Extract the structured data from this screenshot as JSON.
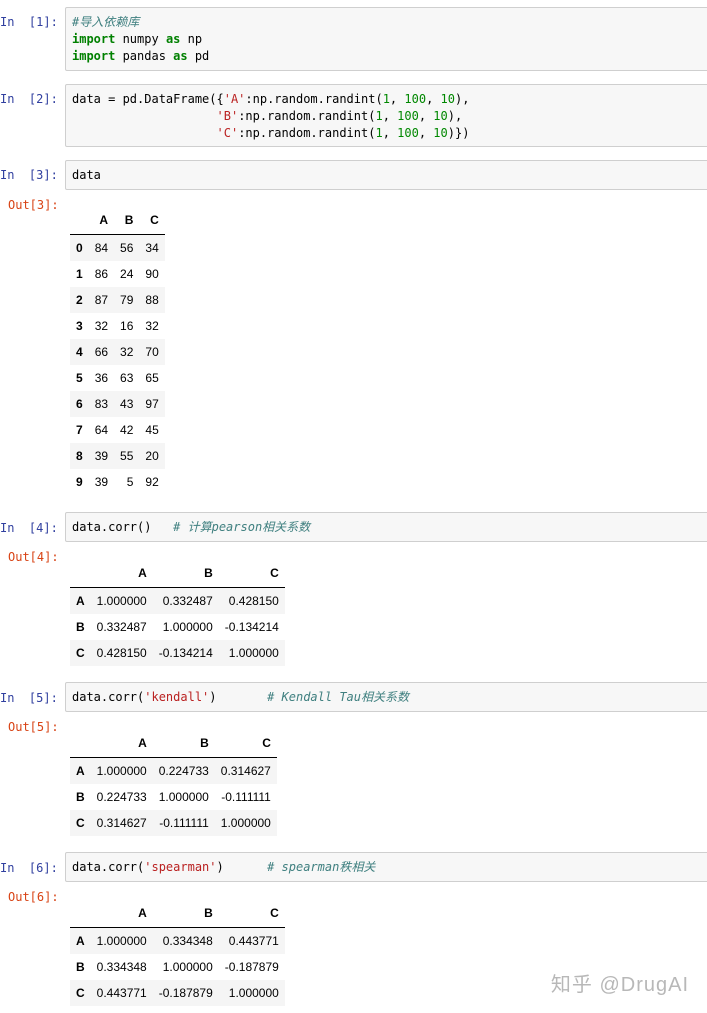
{
  "cells": [
    {
      "prompt": "In  [1]:",
      "lines": [
        [
          {
            "t": "#导入依赖库",
            "c": "cmt"
          }
        ],
        [
          {
            "t": "import",
            "c": "kw"
          },
          {
            "t": " numpy "
          },
          {
            "t": "as",
            "c": "kw"
          },
          {
            "t": " np"
          }
        ],
        [
          {
            "t": "import",
            "c": "kw"
          },
          {
            "t": " pandas "
          },
          {
            "t": "as",
            "c": "kw"
          },
          {
            "t": " pd"
          }
        ]
      ]
    },
    {
      "prompt": "In  [2]:",
      "lines": [
        [
          {
            "t": "data = pd.DataFrame({"
          },
          {
            "t": "'A'",
            "c": "str"
          },
          {
            "t": ":np.random.randint("
          },
          {
            "t": "1",
            "c": "num"
          },
          {
            "t": ", "
          },
          {
            "t": "100",
            "c": "num"
          },
          {
            "t": ", "
          },
          {
            "t": "10",
            "c": "num"
          },
          {
            "t": "),"
          }
        ],
        [
          {
            "t": "                    "
          },
          {
            "t": "'B'",
            "c": "str"
          },
          {
            "t": ":np.random.randint("
          },
          {
            "t": "1",
            "c": "num"
          },
          {
            "t": ", "
          },
          {
            "t": "100",
            "c": "num"
          },
          {
            "t": ", "
          },
          {
            "t": "10",
            "c": "num"
          },
          {
            "t": "),"
          }
        ],
        [
          {
            "t": "                    "
          },
          {
            "t": "'C'",
            "c": "str"
          },
          {
            "t": ":np.random.randint("
          },
          {
            "t": "1",
            "c": "num"
          },
          {
            "t": ", "
          },
          {
            "t": "100",
            "c": "num"
          },
          {
            "t": ", "
          },
          {
            "t": "10",
            "c": "num"
          },
          {
            "t": ")})"
          }
        ]
      ]
    },
    {
      "prompt": "In  [3]:",
      "lines": [
        [
          {
            "t": "data"
          }
        ]
      ]
    },
    {
      "prompt": "In  [4]:",
      "lines": [
        [
          {
            "t": "data.corr()   "
          },
          {
            "t": "# 计算pearson相关系数",
            "c": "cmt"
          }
        ]
      ]
    },
    {
      "prompt": "In  [5]:",
      "lines": [
        [
          {
            "t": "data.corr("
          },
          {
            "t": "'kendall'",
            "c": "str"
          },
          {
            "t": ")       "
          },
          {
            "t": "# Kendall Tau相关系数",
            "c": "cmt"
          }
        ]
      ]
    },
    {
      "prompt": "In  [6]:",
      "lines": [
        [
          {
            "t": "data.corr("
          },
          {
            "t": "'spearman'",
            "c": "str"
          },
          {
            "t": ")      "
          },
          {
            "t": "# spearman秩相关",
            "c": "cmt"
          }
        ]
      ]
    }
  ],
  "outputs": [
    {
      "prompt": "Out[3]:",
      "columns": [
        "",
        "A",
        "B",
        "C"
      ],
      "rows": [
        [
          "0",
          "84",
          "56",
          "34"
        ],
        [
          "1",
          "86",
          "24",
          "90"
        ],
        [
          "2",
          "87",
          "79",
          "88"
        ],
        [
          "3",
          "32",
          "16",
          "32"
        ],
        [
          "4",
          "66",
          "32",
          "70"
        ],
        [
          "5",
          "36",
          "63",
          "65"
        ],
        [
          "6",
          "83",
          "43",
          "97"
        ],
        [
          "7",
          "64",
          "42",
          "45"
        ],
        [
          "8",
          "39",
          "55",
          "20"
        ],
        [
          "9",
          "39",
          "5",
          "92"
        ]
      ]
    },
    {
      "prompt": "Out[4]:",
      "columns": [
        "",
        "A",
        "B",
        "C"
      ],
      "rows": [
        [
          "A",
          "1.000000",
          "0.332487",
          "0.428150"
        ],
        [
          "B",
          "0.332487",
          "1.000000",
          "-0.134214"
        ],
        [
          "C",
          "0.428150",
          "-0.134214",
          "1.000000"
        ]
      ]
    },
    {
      "prompt": "Out[5]:",
      "columns": [
        "",
        "A",
        "B",
        "C"
      ],
      "rows": [
        [
          "A",
          "1.000000",
          "0.224733",
          "0.314627"
        ],
        [
          "B",
          "0.224733",
          "1.000000",
          "-0.111111"
        ],
        [
          "C",
          "0.314627",
          "-0.111111",
          "1.000000"
        ]
      ]
    },
    {
      "prompt": "Out[6]:",
      "columns": [
        "",
        "A",
        "B",
        "C"
      ],
      "rows": [
        [
          "A",
          "1.000000",
          "0.334348",
          "0.443771"
        ],
        [
          "B",
          "0.334348",
          "1.000000",
          "-0.187879"
        ],
        [
          "C",
          "0.443771",
          "-0.187879",
          "1.000000"
        ]
      ]
    }
  ],
  "watermark": "知乎 @DrugAI"
}
